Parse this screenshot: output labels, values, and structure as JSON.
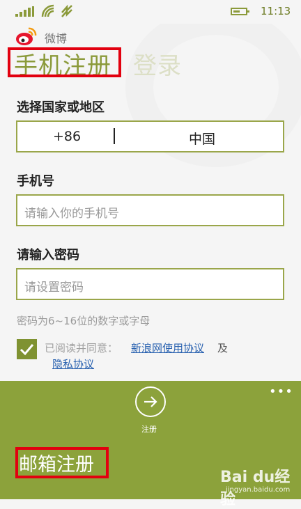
{
  "status_bar": {
    "time": "11:13"
  },
  "app": {
    "name": "微博"
  },
  "tabs": {
    "register": "手机注册",
    "login": "登录"
  },
  "form": {
    "region_label": "选择国家或地区",
    "country_code": "+86",
    "country_name": "中国",
    "phone_label": "手机号",
    "phone_placeholder": "请输入你的手机号",
    "password_label": "请输入密码",
    "password_placeholder": "请设置密码",
    "password_hint": "密码为6~16位的数字或字母"
  },
  "agreement": {
    "prefix": "已阅读并同意：",
    "link_terms": "新浪网使用协议",
    "and": "及",
    "link_privacy": "隐私协议",
    "checked": true
  },
  "appbar": {
    "more": "•••",
    "register_label": "注册",
    "email_register": "邮箱注册"
  },
  "watermark": {
    "brand": "Bai du经验",
    "url": "jingyan.baidu.com"
  },
  "colors": {
    "accent": "#8ca23b",
    "highlight": "#e2000f",
    "link": "#2a62b0"
  }
}
